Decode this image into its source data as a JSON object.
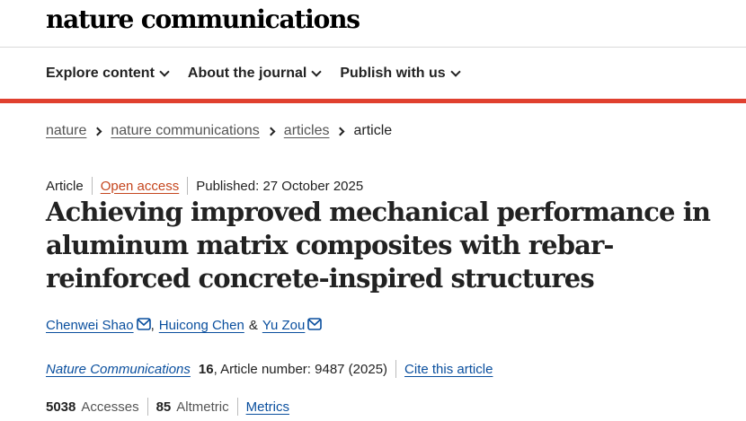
{
  "site": {
    "logo": "nature communications"
  },
  "nav": {
    "items": [
      {
        "label": "Explore content"
      },
      {
        "label": "About the journal"
      },
      {
        "label": "Publish with us"
      }
    ]
  },
  "breadcrumb": {
    "items": [
      "nature",
      "nature communications",
      "articles"
    ],
    "current": "article"
  },
  "article": {
    "type": "Article",
    "access": "Open access",
    "published": "Published: 27 October 2025",
    "title": "Achieving improved mechanical performance in aluminum matrix composites with rebar-reinforced concrete-inspired structures",
    "authors": [
      {
        "name": "Chenwei Shao",
        "has_email": true
      },
      {
        "name": "Huicong Chen",
        "has_email": false
      },
      {
        "name": "Yu Zou",
        "has_email": true
      }
    ],
    "author_sep_1": ",",
    "author_sep_2": "&",
    "journal": "Nature Communications",
    "volume": "16",
    "article_number": ", Article number: 9487 (2025)",
    "cite_label": "Cite this article"
  },
  "stats": {
    "accesses_value": "5038",
    "accesses_label": "Accesses",
    "altmetric_value": "85",
    "altmetric_label": "Altmetric",
    "metrics_label": "Metrics"
  },
  "colors": {
    "accent_bar": "#e0402f",
    "link_blue": "#0a4f9e",
    "open_access": "#c5461e"
  },
  "icons": {
    "nav_chevron": "chevron-down-icon",
    "breadcrumb_sep": "chevron-right-icon",
    "author_email": "envelope-icon"
  }
}
